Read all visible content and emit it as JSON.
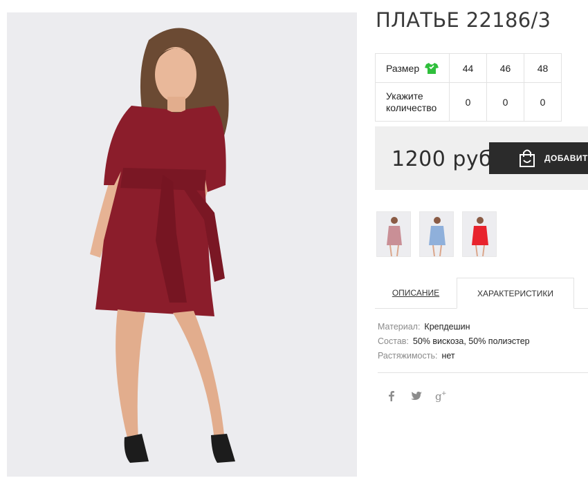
{
  "product": {
    "title": "ПЛАТЬЕ 22186/3"
  },
  "sizes": {
    "size_label": "Размер",
    "qty_label": "Укажите количество",
    "values": [
      "44",
      "46",
      "48"
    ],
    "quantities": [
      "0",
      "0",
      "0"
    ]
  },
  "purchase": {
    "price": "1200 руб",
    "add_button": "ДОБАВИТЬ"
  },
  "thumbnails": [
    {
      "color": "#c98f96",
      "name": "pink"
    },
    {
      "color": "#8fb0db",
      "name": "blue"
    },
    {
      "color": "#e8232d",
      "name": "red"
    }
  ],
  "tabs": {
    "description": "ОПИСАНИЕ",
    "specifications": "ХАРАКТЕРИСТИКИ"
  },
  "specs": [
    {
      "key": "Материал:",
      "value": "Крепдешин"
    },
    {
      "key": "Состав:",
      "value": "50% вискоза, 50% полиэстер"
    },
    {
      "key": "Растяжимость:",
      "value": "нет"
    }
  ],
  "social": [
    "facebook-icon",
    "twitter-icon",
    "google-plus-icon"
  ],
  "colors": {
    "dress": "#8b1d2b",
    "button_bg": "#2b2b2b",
    "price_box_bg": "#efefef",
    "size_icon": "#2fbf3c"
  }
}
